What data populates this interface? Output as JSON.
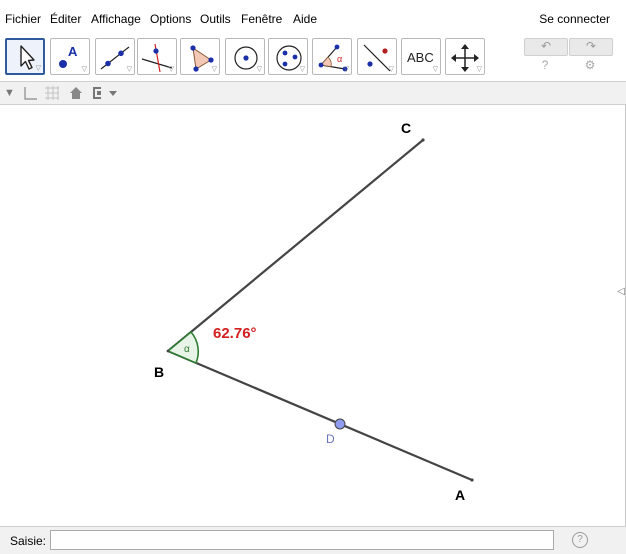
{
  "menu": {
    "items": [
      "Fichier",
      "Éditer",
      "Affichage",
      "Options",
      "Outils",
      "Fenêtre",
      "Aide"
    ],
    "connect_label": "Se connecter"
  },
  "toolbar": {
    "tools": [
      {
        "name": "move-tool",
        "icon": "arrow-cursor-icon",
        "active": true
      },
      {
        "name": "point-tool",
        "icon": "point-a-icon",
        "letter": "A"
      },
      {
        "name": "line-tool",
        "icon": "line-through-two-points-icon"
      },
      {
        "name": "perpendicular-line-tool",
        "icon": "perpendicular-line-icon"
      },
      {
        "name": "polygon-tool",
        "icon": "polygon-icon"
      },
      {
        "name": "circle-tool",
        "icon": "circle-center-point-icon"
      },
      {
        "name": "circle-three-points-tool",
        "icon": "circle-three-points-icon"
      },
      {
        "name": "angle-tool",
        "icon": "angle-icon",
        "symbol": "α"
      },
      {
        "name": "reflect-tool",
        "icon": "reflect-about-line-icon"
      },
      {
        "name": "text-tool",
        "icon": "text-icon",
        "text": "ABC"
      },
      {
        "name": "move-view-tool",
        "icon": "move-graphics-view-icon"
      }
    ],
    "undo_icon": "undo-icon",
    "redo_icon": "redo-icon",
    "help_icon": "help-icon",
    "settings_icon": "gear-icon"
  },
  "stylebar": {
    "icons": [
      "toggle-style-bar-icon",
      "axes-icon",
      "grid-icon",
      "home-view-icon",
      "point-capturing-icon"
    ]
  },
  "graphics": {
    "angle_value": "62.76°",
    "angle_symbol": "α",
    "points": {
      "A": {
        "label": "A"
      },
      "B": {
        "label": "B"
      },
      "C": {
        "label": "C"
      },
      "D": {
        "label": "D"
      }
    },
    "colors": {
      "segment": "#444444",
      "angle_label": "#d32020",
      "angle_fill": "#e9f4e9",
      "angle_stroke": "#2e7d32",
      "point_d_fill": "#8f9cf0",
      "point_d_label": "#6a74b8"
    }
  },
  "inputbar": {
    "label": "Saisie:",
    "value": "",
    "placeholder": ""
  }
}
